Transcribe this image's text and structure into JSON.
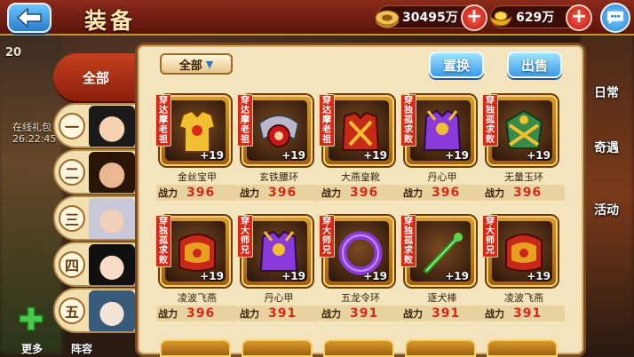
{
  "header": {
    "title": "装备",
    "silver_value": "30495万",
    "gold_value": "629万"
  },
  "background_left": {
    "label_top": "20",
    "label_gift": "在线礼包",
    "timer": "26:22:45"
  },
  "side_menu": [
    "日常",
    "奇遇",
    "活动"
  ],
  "tabs": {
    "all": "全部",
    "heroes": [
      "一",
      "二",
      "三",
      "四",
      "五"
    ]
  },
  "toolbar": {
    "filter_label": "全部",
    "filter_arrow": "▼",
    "swap_label": "置换",
    "sell_label": "出售"
  },
  "power_label": "战力",
  "items": [
    {
      "wearer": "达摩老祖",
      "level": "+19",
      "name": "金丝宝甲",
      "power": "396",
      "kind": "armor-gold"
    },
    {
      "wearer": "达摩老祖",
      "level": "+19",
      "name": "玄铁腰环",
      "power": "396",
      "kind": "belt-red"
    },
    {
      "wearer": "达摩老祖",
      "level": "+19",
      "name": "大燕皇靴",
      "power": "396",
      "kind": "armor-red"
    },
    {
      "wearer": "独孤求败",
      "level": "+19",
      "name": "丹心甲",
      "power": "396",
      "kind": "armor-purple"
    },
    {
      "wearer": "独孤求败",
      "level": "+19",
      "name": "无量玉环",
      "power": "396",
      "kind": "ring-gold"
    },
    {
      "wearer": "独孤求败",
      "level": "+19",
      "name": "凌波飞燕",
      "power": "396",
      "kind": "boots-red"
    },
    {
      "wearer": "大师兄",
      "level": "+19",
      "name": "丹心甲",
      "power": "391",
      "kind": "armor-purple"
    },
    {
      "wearer": "大师兄",
      "level": "+19",
      "name": "五龙令环",
      "power": "391",
      "kind": "ring-purple"
    },
    {
      "wearer": "独孤求败",
      "level": "+19",
      "name": "逐犬棒",
      "power": "391",
      "kind": "staff-green"
    },
    {
      "wearer": "大师兄",
      "level": "+19",
      "name": "凌波飞燕",
      "power": "391",
      "kind": "boots-red"
    }
  ],
  "wear_prefix": "穿",
  "bottom_labels": [
    "更多",
    "阵容"
  ],
  "colors": {
    "accent_red": "#d82818",
    "panel_bg": "#f3e4be",
    "button_blue": "#3a9ae6"
  }
}
